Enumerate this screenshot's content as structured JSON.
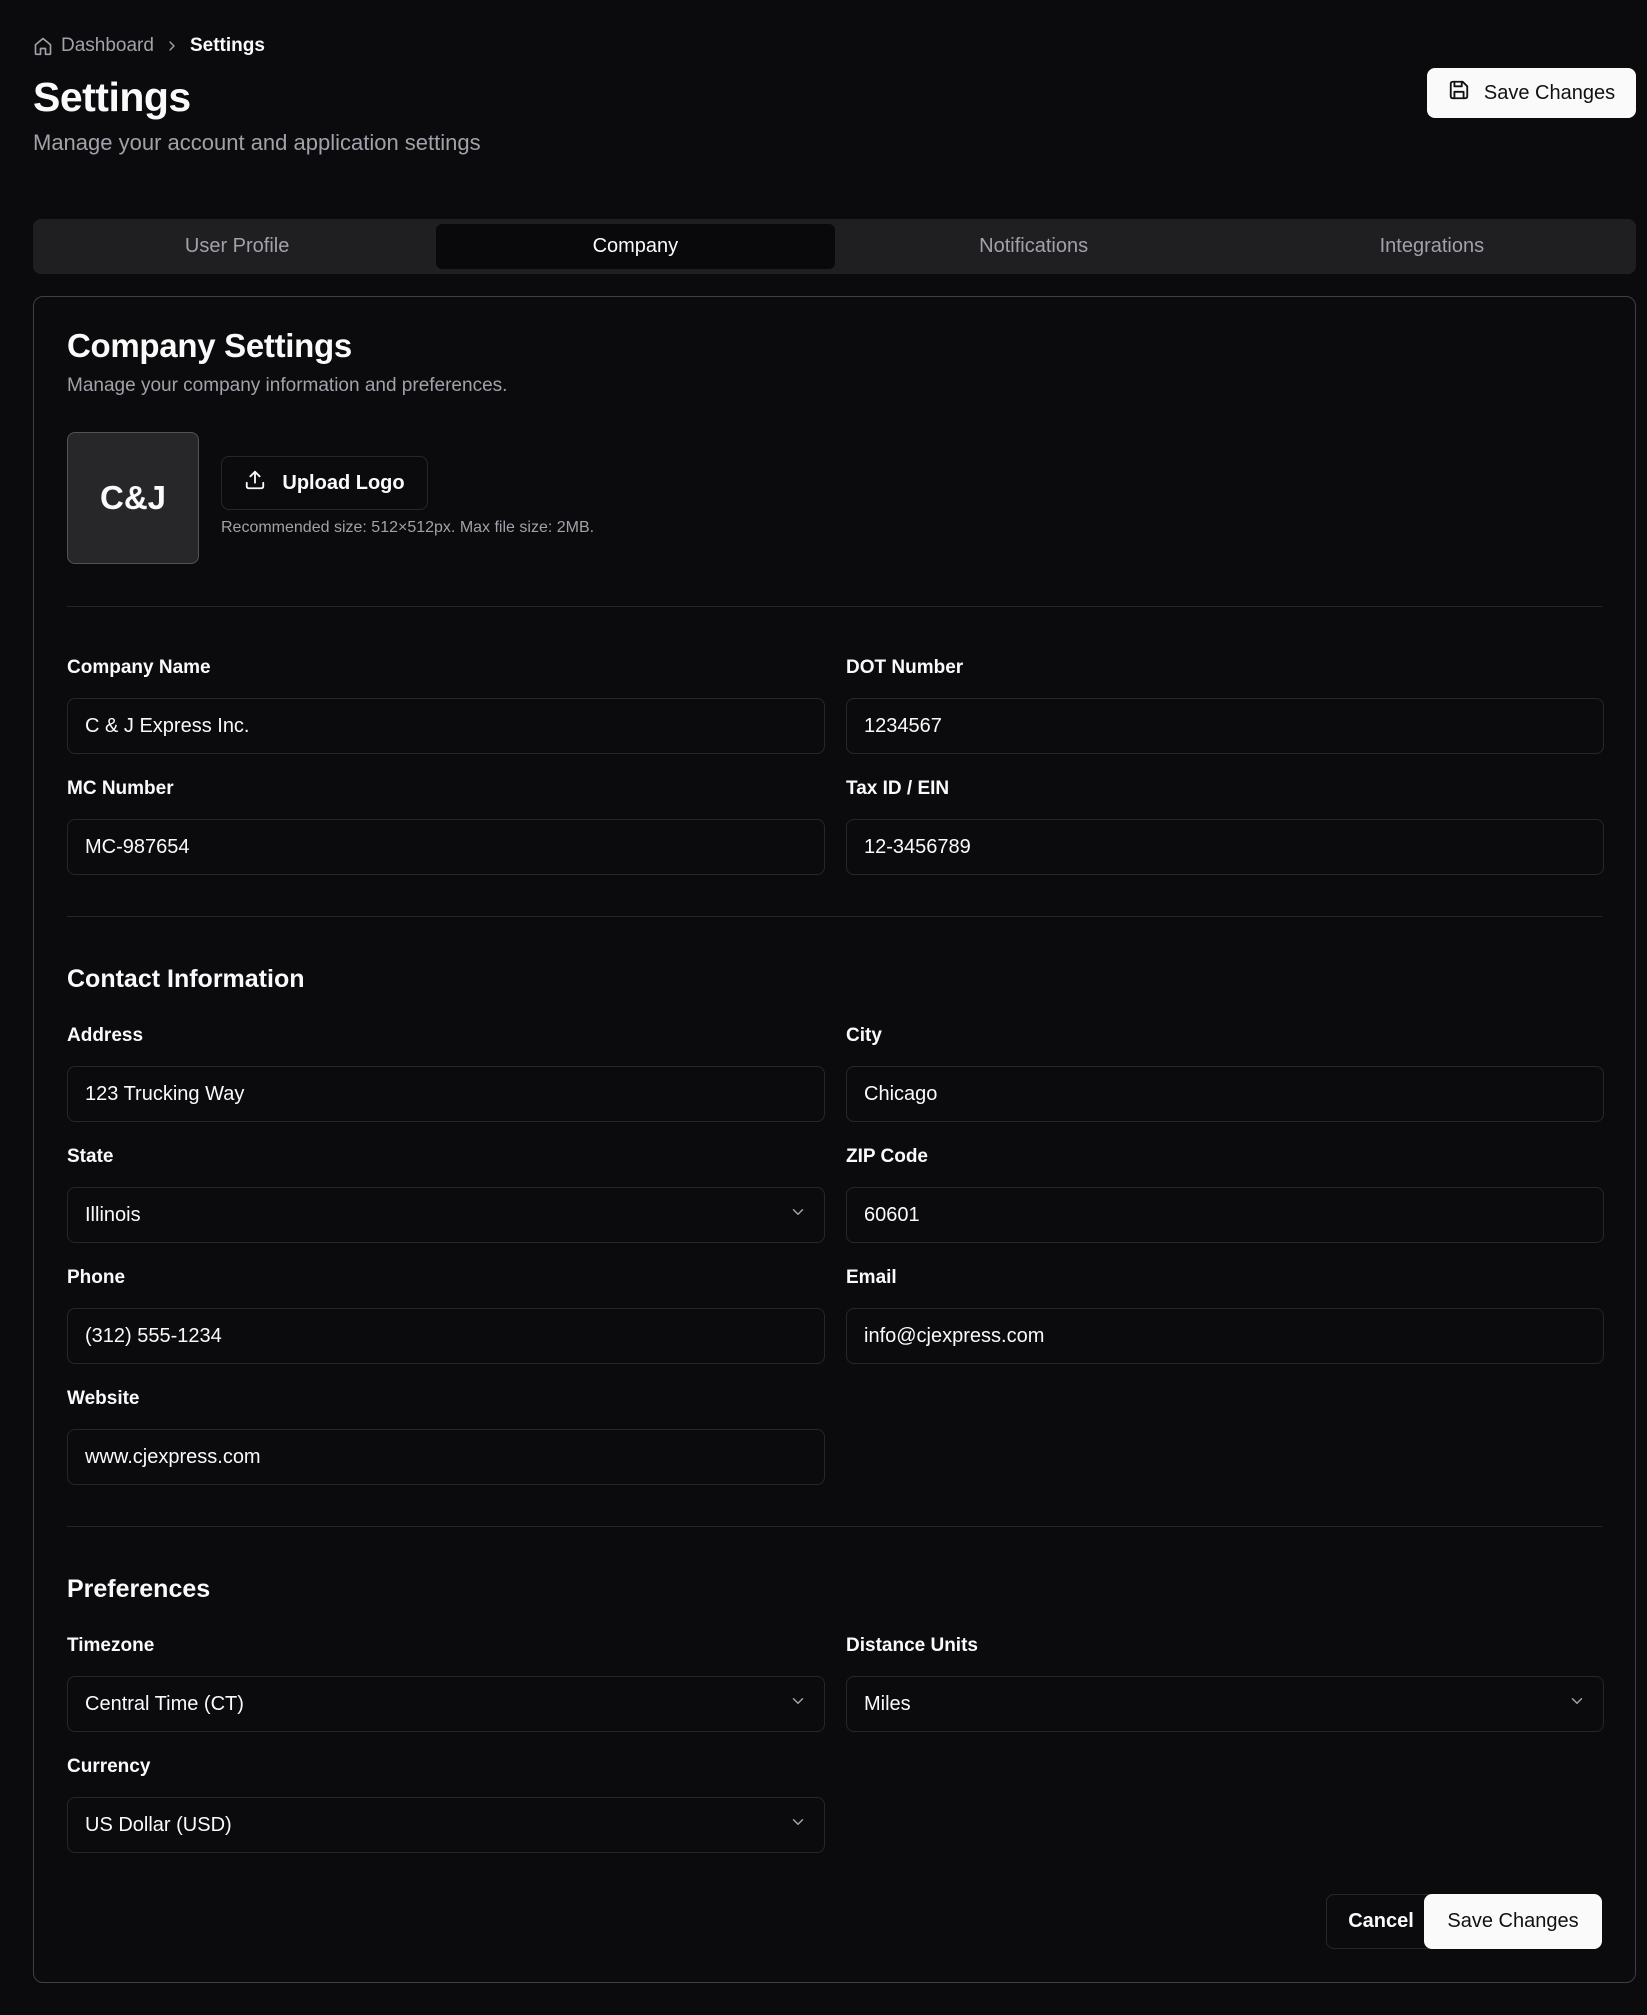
{
  "breadcrumb": {
    "home": "Dashboard",
    "current": "Settings"
  },
  "header": {
    "title": "Settings",
    "subtitle": "Manage your account and application settings",
    "save_label": "Save Changes"
  },
  "tabs": [
    {
      "label": "User Profile"
    },
    {
      "label": "Company"
    },
    {
      "label": "Notifications"
    },
    {
      "label": "Integrations"
    }
  ],
  "card": {
    "title": "Company Settings",
    "description": "Manage your company information and preferences.",
    "logo_text": "C&J",
    "upload_label": "Upload Logo",
    "upload_hint": "Recommended size: 512×512px. Max file size: 2MB."
  },
  "company": {
    "company_name": {
      "label": "Company Name",
      "value": "C & J Express Inc."
    },
    "dot_number": {
      "label": "DOT Number",
      "value": "1234567"
    },
    "mc_number": {
      "label": "MC Number",
      "value": "MC-987654"
    },
    "tax_id": {
      "label": "Tax ID / EIN",
      "value": "12-3456789"
    }
  },
  "contact": {
    "heading": "Contact Information",
    "address": {
      "label": "Address",
      "value": "123 Trucking Way"
    },
    "city": {
      "label": "City",
      "value": "Chicago"
    },
    "state": {
      "label": "State",
      "value": "Illinois"
    },
    "zip": {
      "label": "ZIP Code",
      "value": "60601"
    },
    "phone": {
      "label": "Phone",
      "value": "(312) 555-1234"
    },
    "email": {
      "label": "Email",
      "value": "info@cjexpress.com"
    },
    "website": {
      "label": "Website",
      "value": "www.cjexpress.com"
    }
  },
  "preferences": {
    "heading": "Preferences",
    "timezone": {
      "label": "Timezone",
      "value": "Central Time (CT)"
    },
    "distance_units": {
      "label": "Distance Units",
      "value": "Miles"
    },
    "currency": {
      "label": "Currency",
      "value": "US Dollar (USD)"
    }
  },
  "footer": {
    "cancel_label": "Cancel",
    "save_label": "Save Changes"
  },
  "icons": [
    "home-icon",
    "chevron-right-icon",
    "save-icon",
    "upload-icon",
    "chevron-down-icon"
  ],
  "colors": {
    "background": "#0b0b0d",
    "primary_button": "#fafafa",
    "active_tab": "#09090b",
    "muted_text": "#a1a1aa"
  }
}
